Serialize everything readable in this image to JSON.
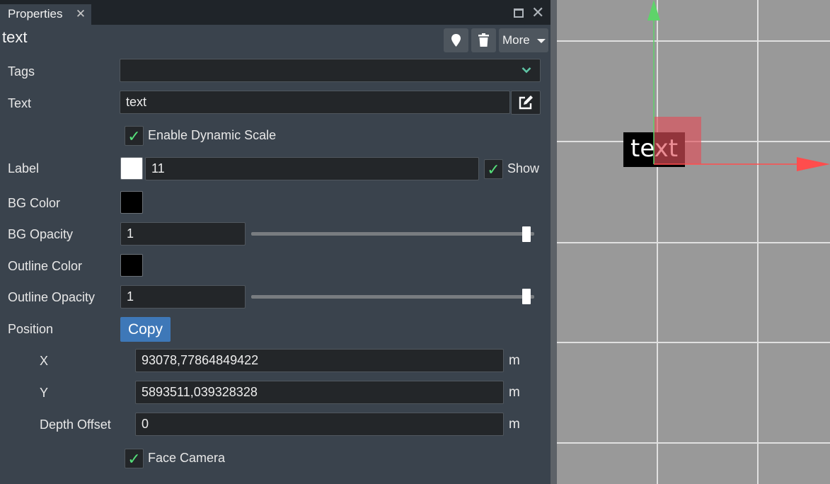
{
  "panel": {
    "tab_title": "Properties",
    "tab_close_glyph": "✕",
    "window_close_glyph": "✕",
    "object_title": "text",
    "toolbar": {
      "pin_icon": "map-pin-icon",
      "trash_icon": "trash-icon",
      "more_label": "More"
    }
  },
  "properties": {
    "tags": {
      "label": "Tags",
      "value": ""
    },
    "text": {
      "label": "Text",
      "value": "text"
    },
    "dynamic_scale": {
      "label": "Enable Dynamic Scale",
      "checked": true,
      "check_glyph": "✓"
    },
    "label": {
      "label": "Label",
      "color": "#ffffff",
      "value": "11",
      "show_label": "Show",
      "show_checked": true,
      "check_glyph": "✓"
    },
    "bg_color": {
      "label": "BG Color",
      "color": "#000000"
    },
    "bg_opacity": {
      "label": "BG Opacity",
      "value": "1",
      "level": 1.0
    },
    "outline_color": {
      "label": "Outline Color",
      "color": "#000000"
    },
    "outline_opacity": {
      "label": "Outline Opacity",
      "value": "1",
      "level": 1.0
    },
    "position": {
      "label": "Position",
      "copy_label": "Copy",
      "x": {
        "label": "X",
        "value": "93078,77864849422",
        "unit": "m"
      },
      "y": {
        "label": "Y",
        "value": "5893511,039328328",
        "unit": "m"
      },
      "depth": {
        "label": "Depth Offset",
        "value": "0",
        "unit": "m"
      }
    },
    "face_camera": {
      "label": "Face Camera",
      "checked": true,
      "check_glyph": "✓"
    }
  },
  "viewport": {
    "label_text": "text",
    "colors": {
      "x_axis": "#ff4d4d",
      "y_axis": "#5ed36a",
      "gizmo_box": "#e0505a",
      "grid": "#e0e0e0"
    }
  }
}
